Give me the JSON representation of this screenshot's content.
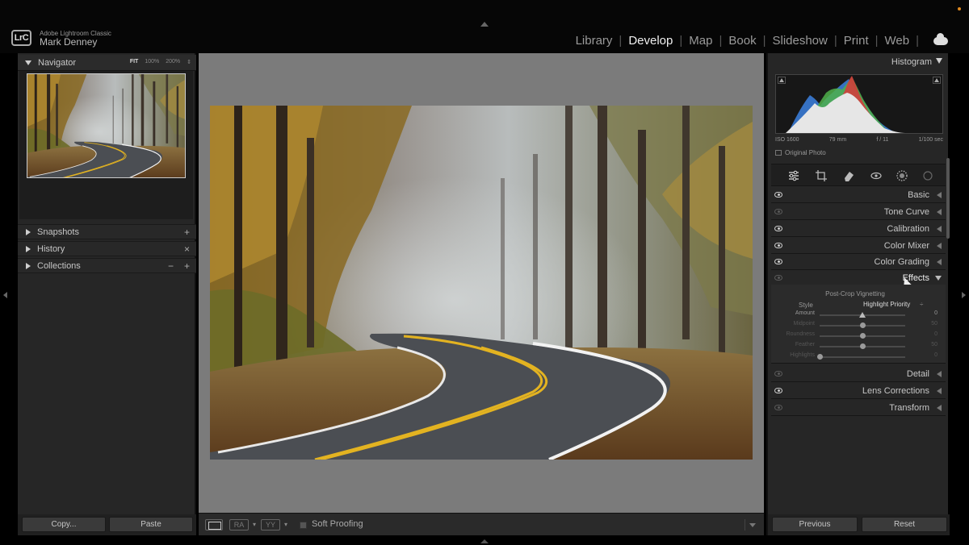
{
  "header": {
    "app_name": "Adobe Lightroom Classic",
    "user_name": "Mark Denney",
    "logo_text": "LrC",
    "modules": [
      {
        "label": "Library",
        "active": false
      },
      {
        "label": "Develop",
        "active": true
      },
      {
        "label": "Map",
        "active": false
      },
      {
        "label": "Book",
        "active": false
      },
      {
        "label": "Slideshow",
        "active": false
      },
      {
        "label": "Print",
        "active": false
      },
      {
        "label": "Web",
        "active": false
      }
    ],
    "separator": "|"
  },
  "left_panel": {
    "navigator": {
      "title": "Navigator",
      "zoom_options": [
        "FIT",
        "100%",
        "200%"
      ],
      "zoom_arrows": "⇕"
    },
    "snapshots": {
      "label": "Snapshots",
      "action": "+"
    },
    "history": {
      "label": "History",
      "action": "×"
    },
    "collections": {
      "label": "Collections",
      "action_minus": "−",
      "action_plus": "+"
    },
    "buttons": {
      "copy": "Copy...",
      "paste": "Paste"
    }
  },
  "toolbar": {
    "ra_label": "RA",
    "yy_label": "YY",
    "caret": "▾",
    "soft_proofing": "Soft Proofing"
  },
  "right_panel": {
    "histogram": {
      "title": "Histogram",
      "iso": "ISO 1600",
      "focal": "79 mm",
      "aperture": "f / 11",
      "shutter": "1/100 sec",
      "original_photo": "Original Photo"
    },
    "sections_top": [
      {
        "label": "Basic",
        "visible": true
      },
      {
        "label": "Tone Curve",
        "visible": false
      },
      {
        "label": "Calibration",
        "visible": true
      },
      {
        "label": "Color Mixer",
        "visible": true
      },
      {
        "label": "Color Grading",
        "visible": true
      }
    ],
    "effects": {
      "label": "Effects",
      "subtitle": "Post-Crop Vignetting",
      "style_label": "Style",
      "style_value": "Highlight Priority",
      "style_caret": "÷",
      "sliders": [
        {
          "label": "Amount",
          "value": "0",
          "position": 0.5,
          "enabled": true
        },
        {
          "label": "Midpoint",
          "value": "50",
          "position": 0.5,
          "enabled": false
        },
        {
          "label": "Roundness",
          "value": "0",
          "position": 0.5,
          "enabled": false
        },
        {
          "label": "Feather",
          "value": "50",
          "position": 0.5,
          "enabled": false
        },
        {
          "label": "Highlights",
          "value": "0",
          "position": 0.0,
          "enabled": false
        }
      ]
    },
    "sections_bottom": [
      {
        "label": "Detail",
        "visible": false
      },
      {
        "label": "Lens Corrections",
        "visible": true
      },
      {
        "label": "Transform",
        "visible": false
      }
    ],
    "buttons": {
      "previous": "Previous",
      "reset": "Reset"
    }
  },
  "colors": {
    "accent_orange": "#e08a1e",
    "panel_bg": "#262626",
    "canvas_gray": "#7b7b7b"
  }
}
